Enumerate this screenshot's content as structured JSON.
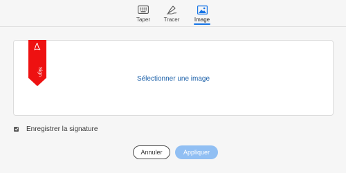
{
  "tabs": [
    {
      "label": "Taper",
      "icon": "keyboard-icon",
      "active": false
    },
    {
      "label": "Tracer",
      "icon": "pen-icon",
      "active": false
    },
    {
      "label": "Image",
      "icon": "image-icon",
      "active": true
    }
  ],
  "dropzone": {
    "select_label": "Sélectionner une image",
    "ribbon_text": "Sign",
    "ribbon_color": "#ee1111"
  },
  "save_signature": {
    "label": "Enregistrer la signature",
    "checked": true
  },
  "buttons": {
    "cancel": "Annuler",
    "apply": "Appliquer"
  },
  "colors": {
    "accent": "#1473e6",
    "link": "#1a5fa8",
    "apply_disabled": "#91bff3"
  }
}
